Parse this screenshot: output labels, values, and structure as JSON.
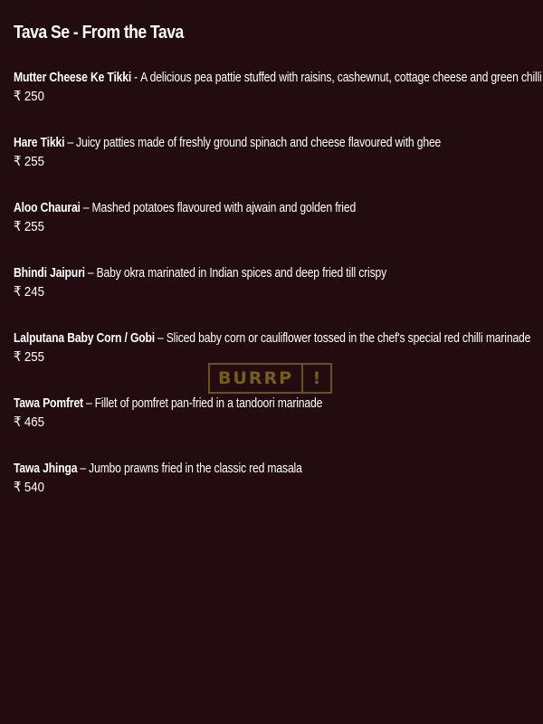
{
  "section": {
    "title": "Tava Se - From the Tava"
  },
  "currency_symbol": "₹",
  "items": [
    {
      "name": "Mutter Cheese Ke Tikki",
      "separator": "-",
      "description": "A delicious pea pattie stuffed with raisins, cashewnut, cottage cheese and green chilli",
      "price": "250"
    },
    {
      "name": "Hare Tikki",
      "separator": "–",
      "description": "Juicy patties made of freshly ground spinach and cheese flavoured with ghee",
      "price": "255"
    },
    {
      "name": "Aloo Chaurai",
      "separator": "–",
      "description": "Mashed potatoes flavoured with ajwain and golden fried",
      "price": "255"
    },
    {
      "name": "Bhindi Jaipuri",
      "separator": "–",
      "description": "Baby okra marinated in Indian spices and deep fried till crispy",
      "price": "245"
    },
    {
      "name": "Lalputana Baby Corn / Gobi",
      "separator": "–",
      "description": "Sliced baby corn or cauliflower tossed in the chef's special red chilli marinade",
      "price": "255"
    },
    {
      "name": "Tawa Pomfret",
      "separator": "–",
      "description": "Fillet of pomfret pan-fried in a tandoori marinade",
      "price": "465"
    },
    {
      "name": "Tawa Jhinga",
      "separator": "–",
      "description": "Jumbo prawns fried in the classic red masala",
      "price": "540"
    }
  ],
  "watermark": {
    "text": "BURRP",
    "mark": "!"
  },
  "colors": {
    "background": "#230c10",
    "text": "#ffffff",
    "watermark": "#7a6319"
  }
}
